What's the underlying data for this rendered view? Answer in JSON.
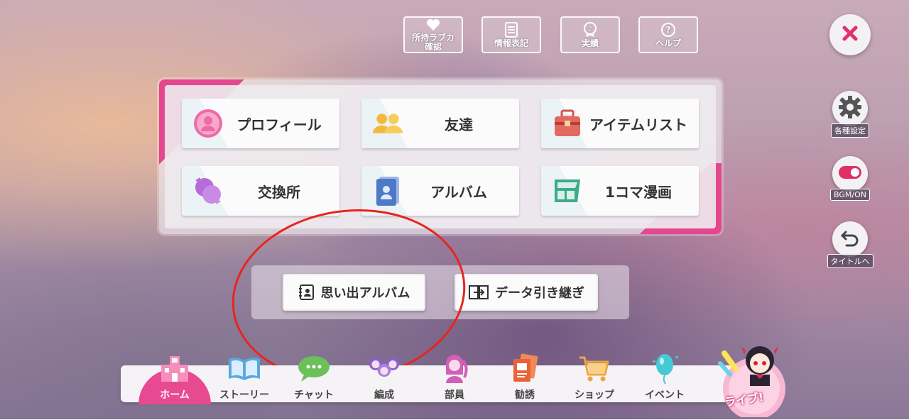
{
  "top_buttons": [
    {
      "label": "所持ラブカ\n確認",
      "icon": "heart-icon"
    },
    {
      "label": "情報表記",
      "icon": "document-icon"
    },
    {
      "label": "実績",
      "icon": "medal-icon"
    },
    {
      "label": "ヘルプ",
      "icon": "help-icon"
    }
  ],
  "side_buttons": {
    "close": {
      "icon": "close-icon",
      "color": "#e0306a"
    },
    "settings": {
      "label": "各種設定",
      "icon": "gear-icon"
    },
    "bgm": {
      "label": "BGM/ON",
      "icon": "toggle-icon"
    },
    "title": {
      "label": "タイトルへ",
      "icon": "return-icon"
    }
  },
  "menu": {
    "items": [
      {
        "label": "プロフィール",
        "icon": "profile-icon"
      },
      {
        "label": "友達",
        "icon": "friends-icon"
      },
      {
        "label": "アイテムリスト",
        "icon": "bag-icon"
      },
      {
        "label": "交換所",
        "icon": "exchange-icon"
      },
      {
        "label": "アルバム",
        "icon": "album-icon"
      },
      {
        "label": "1コマ漫画",
        "icon": "manga-icon"
      }
    ]
  },
  "sub_buttons": [
    {
      "label": "思い出アルバム",
      "icon": "memory-album-icon"
    },
    {
      "label": "データ引き継ぎ",
      "icon": "data-transfer-icon"
    }
  ],
  "nav": {
    "items": [
      {
        "label": "ホーム",
        "icon": "school-icon",
        "active": true
      },
      {
        "label": "ストーリー",
        "icon": "book-icon"
      },
      {
        "label": "チャット",
        "icon": "chat-icon"
      },
      {
        "label": "編成",
        "icon": "members-icon"
      },
      {
        "label": "部員",
        "icon": "character-icon"
      },
      {
        "label": "勧誘",
        "icon": "cards-icon"
      },
      {
        "label": "ショップ",
        "icon": "cart-icon"
      },
      {
        "label": "イベント",
        "icon": "balloon-icon"
      }
    ],
    "live_label": "ライブ!"
  },
  "colors": {
    "accent": "#e84a92",
    "annotation": "#e8241e"
  }
}
